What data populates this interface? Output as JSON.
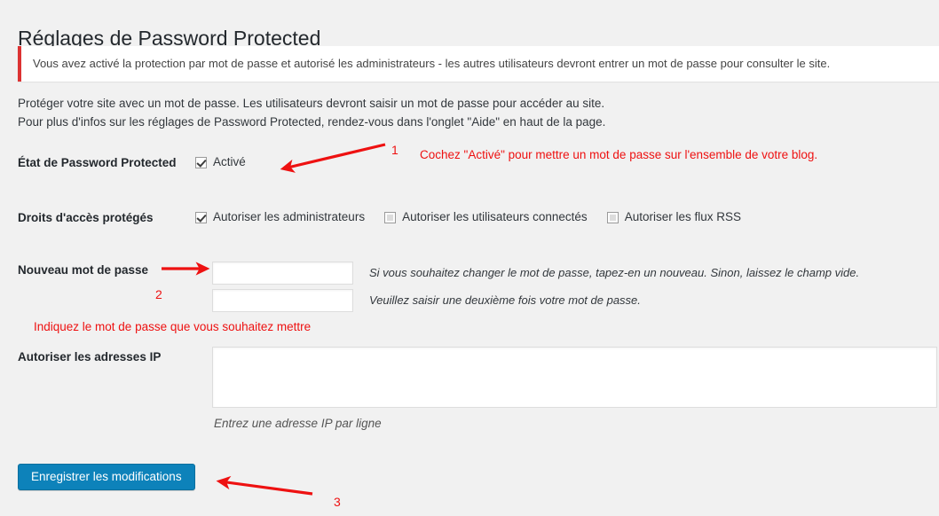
{
  "page": {
    "title": "Réglages de Password Protected",
    "notice": "Vous avez activé la protection par mot de passe et autorisé les administrateurs - les autres utilisateurs devront entrer un mot de passe pour consulter le site.",
    "intro_line1": "Protéger votre site avec un mot de passe. Les utilisateurs devront saisir un mot de passe pour accéder au site.",
    "intro_line2": "Pour plus d'infos sur les réglages de Password Protected, rendez-vous dans l'onglet \"Aide\" en haut de la page."
  },
  "form": {
    "status": {
      "label": "État de Password Protected",
      "checkbox_label": "Activé",
      "checked": true
    },
    "permissions": {
      "label": "Droits d'accès protégés",
      "options": [
        {
          "label": "Autoriser les administrateurs",
          "checked": true
        },
        {
          "label": "Autoriser les utilisateurs connectés",
          "checked": false
        },
        {
          "label": "Autoriser les flux RSS",
          "checked": false
        }
      ]
    },
    "password": {
      "label": "Nouveau mot de passe",
      "value": "",
      "help": "Si vous souhaitez changer le mot de passe, tapez-en un nouveau. Sinon, laissez le champ vide.",
      "confirm_value": "",
      "confirm_help": "Veuillez saisir une deuxième fois votre mot de passe."
    },
    "ip": {
      "label": "Autoriser les adresses IP",
      "value": "",
      "help": "Entrez une adresse IP par ligne"
    }
  },
  "submit": {
    "label": "Enregistrer les modifications"
  },
  "annotations": {
    "marker1": "1",
    "text1": "Cochez \"Activé\" pour mettre un mot de passe sur l'ensemble de votre blog.",
    "marker2": "2",
    "text2": "Indiquez le mot de passe que vous souhaitez mettre",
    "marker3": "3",
    "color": "#ee1111"
  }
}
